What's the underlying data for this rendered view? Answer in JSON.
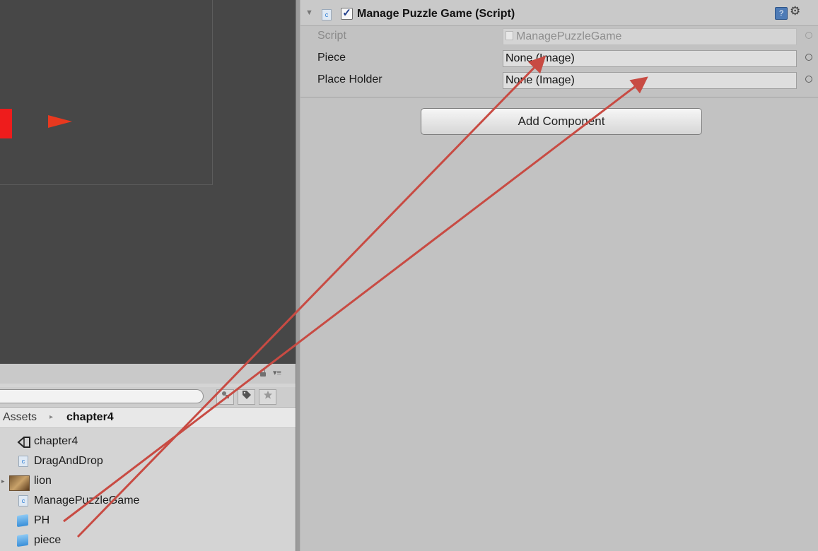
{
  "inspector": {
    "component_title": "Manage Puzzle Game (Script)",
    "properties": [
      {
        "label": "Script",
        "value": "ManagePuzzleGame"
      },
      {
        "label": "Piece",
        "value": "None (Image)"
      },
      {
        "label": "Place Holder",
        "value": "None (Image)"
      }
    ],
    "add_component_label": "Add Component",
    "help_glyph": "?",
    "gear_glyph": "⚙",
    "check_glyph": "✓"
  },
  "project": {
    "breadcrumb_root": "Assets",
    "breadcrumb_sep": "▸",
    "breadcrumb_current": "chapter4",
    "menu_glyph": "▾≡",
    "assets": [
      {
        "name": "chapter4",
        "icon": "unity-scene-icon"
      },
      {
        "name": "DragAndDrop",
        "icon": "script-icon"
      },
      {
        "name": "lion",
        "icon": "image-icon"
      },
      {
        "name": "ManagePuzzleGame",
        "icon": "script-icon"
      },
      {
        "name": "PH",
        "icon": "prefab-icon"
      },
      {
        "name": "piece",
        "icon": "prefab-icon"
      }
    ]
  },
  "colors": {
    "drag_arrow": "#c84b43",
    "scene_bg": "#474747",
    "inspector_bg": "#c2c2c2",
    "scene_object": "#ee1c1c"
  }
}
